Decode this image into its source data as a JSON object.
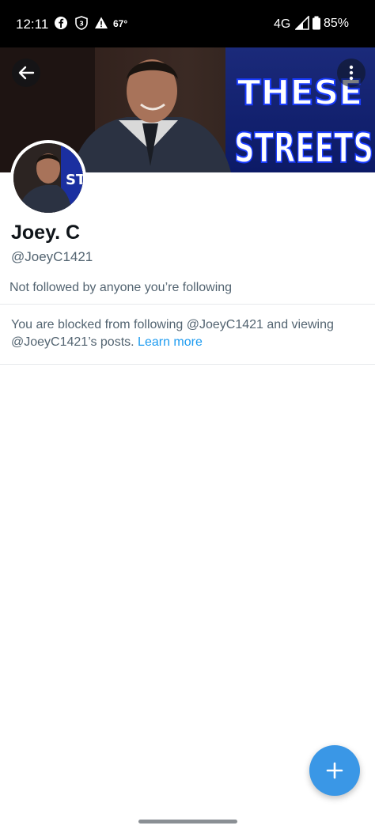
{
  "status_bar": {
    "time": "12:11",
    "temperature": "67°",
    "network": "4G",
    "battery": "85%",
    "icons": [
      "facebook-icon",
      "shield-3-icon",
      "warning-icon",
      "signal-icon",
      "battery-icon"
    ]
  },
  "banner": {
    "text_line1": "THESE",
    "text_line2": "STREETS",
    "accent": "#1a3cff"
  },
  "profile": {
    "name": "Joey. C",
    "handle": "@JoeyC1421",
    "followed_by": "Not followed by anyone you’re following"
  },
  "blocked_notice": {
    "text": "You are blocked from following @JoeyC1421 and viewing @JoeyC1421’s posts.",
    "link": "Learn more",
    "link_color": "#1d9bf0"
  },
  "fab": {
    "icon": "plus-icon",
    "color": "#3a97e6"
  }
}
